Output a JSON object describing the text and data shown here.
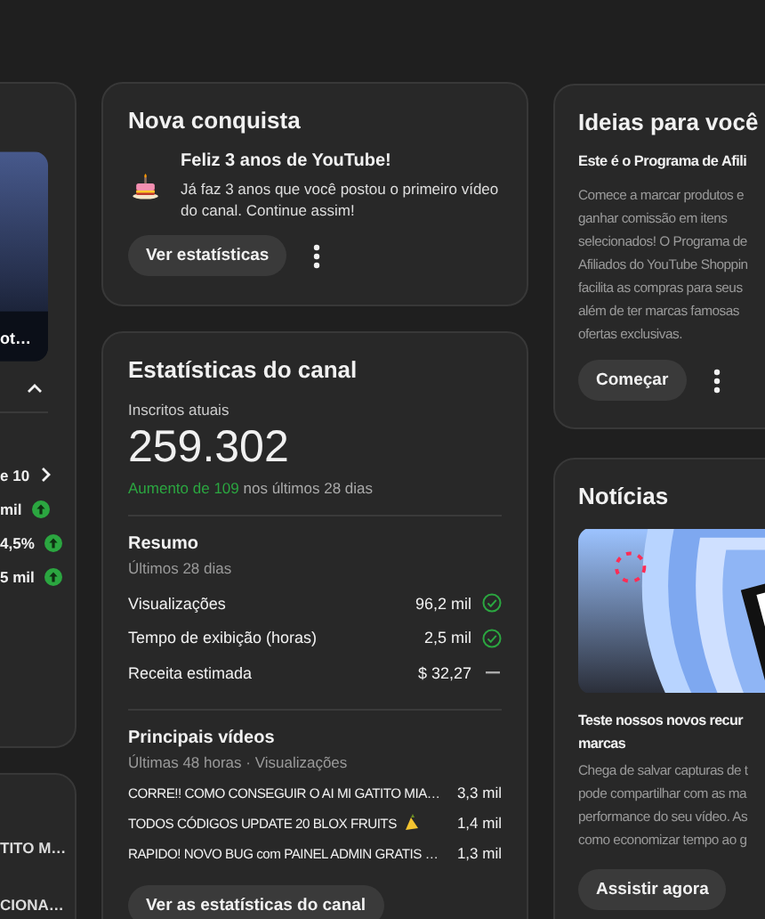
{
  "left_column": {
    "thumbnail": {
      "kind": "picture",
      "caption": "ot…"
    },
    "metrics": [
      {
        "text": "e 10",
        "kind": "link"
      },
      {
        "text": "mil",
        "kind": "up"
      },
      {
        "text": "4,5%",
        "kind": "up"
      },
      {
        "text": "5 mil",
        "kind": "up"
      }
    ],
    "videos": [
      "TITO M…",
      "CIONA…"
    ]
  },
  "achievement": {
    "title": "Nova conquista",
    "heading": "Feliz 3 anos de YouTube!",
    "message": "Já faz 3 anos que você postou o primeiro vídeo do canal. Continue assim!",
    "button": "Ver estatísticas"
  },
  "channel_stats": {
    "title": "Estatísticas do canal",
    "subscribers_label": "Inscritos atuais",
    "subscribers": "259.302",
    "growth_highlight": "Aumento de 109",
    "growth_rest": "nos últimos 28 dias",
    "summary": {
      "title": "Resumo",
      "period": "Últimos 28 dias",
      "rows": [
        {
          "label": "Visualizações",
          "value": "96,2 mil",
          "kind": "check"
        },
        {
          "label": "Tempo de exibição (horas)",
          "value": "2,5 mil",
          "kind": "check"
        },
        {
          "label": "Receita estimada",
          "value": "$ 32,27",
          "kind": "flat"
        }
      ]
    },
    "top_videos": {
      "title": "Principais vídeos",
      "period": "Últimas 48 horas · Visualizações",
      "videos": [
        {
          "title": "CORRE!! COMO CONSEGUIR O AI MI GATITO MIA…",
          "views": "3,3 mil",
          "has_emoji": false
        },
        {
          "title": "TODOS CÓDIGOS UPDATE 20 BLOX FRUITS",
          "views": "1,4 mil",
          "has_emoji": true
        },
        {
          "title": "RAPIDO! NOVO BUG com PAINEL ADMIN GRATIS …",
          "views": "1,3 mil",
          "has_emoji": false
        }
      ]
    },
    "button": "Ver as estatísticas do canal"
  },
  "ideas": {
    "title": "Ideias para você",
    "heading": "Este é o Programa de Afili",
    "lines": [
      "Comece a marcar produtos e",
      "ganhar comissão em itens",
      "selecionados! O Programa de",
      "Afiliados do YouTube Shoppin",
      "facilita as compras para seus",
      "além de ter marcas famosas",
      "ofertas exclusivas."
    ],
    "button": "Começar"
  },
  "news": {
    "title": "Notícias",
    "media": {
      "kind": "picture"
    },
    "heading_lines": [
      "Teste nossos novos recur",
      "marcas"
    ],
    "lines": [
      "Chega de salvar capturas de t",
      "pode compartilhar com as ma",
      "performance do seu vídeo. As",
      "como economizar tempo ao g"
    ],
    "button": "Assistir agora"
  }
}
